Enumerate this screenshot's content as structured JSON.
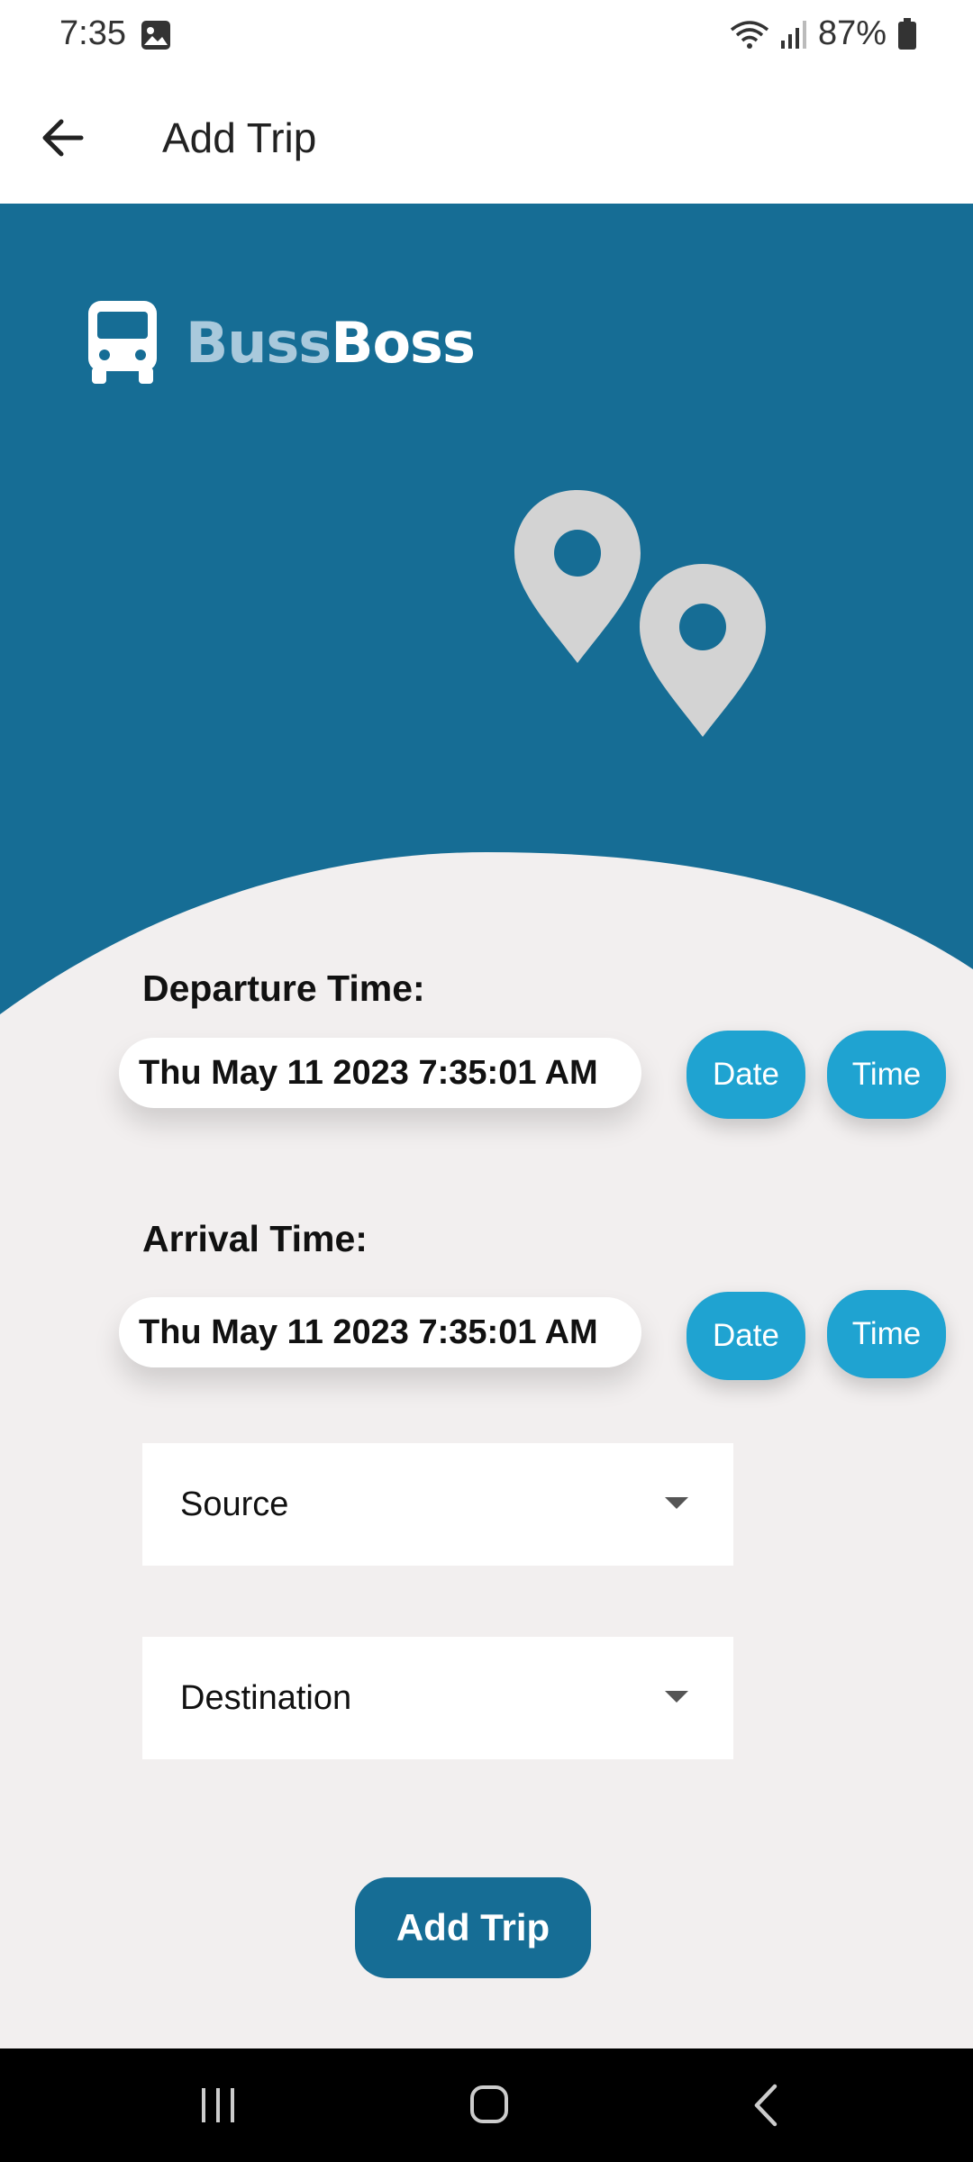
{
  "status_bar": {
    "time": "7:35",
    "battery": "87%",
    "icons": [
      "image-icon",
      "wifi-icon",
      "signal-icon",
      "battery-icon"
    ]
  },
  "app_bar": {
    "title": "Add Trip",
    "back_icon": "arrow-left-icon"
  },
  "hero": {
    "logo_part1": "Buss",
    "logo_part2": "Boss",
    "logo_icon": "bus-icon",
    "illustration": "map-pins-icon"
  },
  "form": {
    "departure": {
      "label": "Departure Time:",
      "value": "Thu May 11 2023 7:35:01 AM",
      "date_button": "Date",
      "time_button": "Time"
    },
    "arrival": {
      "label": "Arrival Time:",
      "value": "Thu May 11 2023 7:35:01 AM",
      "date_button": "Date",
      "time_button": "Time"
    },
    "source": {
      "placeholder": "Source"
    },
    "destination": {
      "placeholder": "Destination"
    },
    "submit_label": "Add Trip"
  },
  "colors": {
    "primary": "#166d95",
    "accent": "#1fa3d1",
    "background": "#f2efef",
    "pin": "#d3d3d3"
  },
  "nav_bar": {
    "icons": [
      "recent-apps-icon",
      "home-icon",
      "back-icon"
    ]
  }
}
